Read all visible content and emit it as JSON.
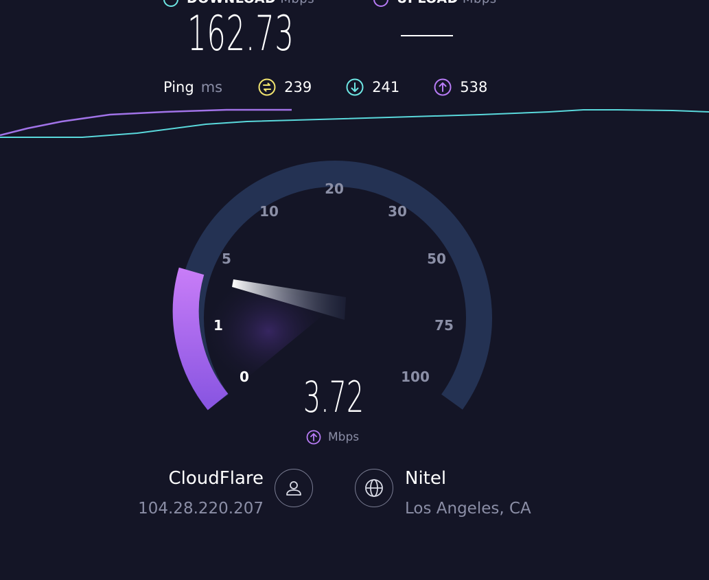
{
  "header": {
    "download": {
      "label": "DOWNLOAD",
      "unit": "Mbps",
      "value": "162.73"
    },
    "upload": {
      "label": "UPLOAD",
      "unit": "Mbps",
      "value": ""
    }
  },
  "ping": {
    "label": "Ping",
    "unit": "ms",
    "idle": "239",
    "download": "241",
    "upload": "538"
  },
  "gauge": {
    "labels": [
      "0",
      "1",
      "5",
      "10",
      "20",
      "30",
      "50",
      "75",
      "100"
    ],
    "value": "3.72",
    "unit": "Mbps",
    "mode": "upload"
  },
  "provider": {
    "name": "CloudFlare",
    "ip": "104.28.220.207"
  },
  "server": {
    "name": "Nitel",
    "location": "Los Angeles, CA"
  },
  "colors": {
    "background": "#141526",
    "download_accent": "#6ee7e4",
    "upload_accent": "#b77bf5",
    "idle_ping": "#f1e46f",
    "gauge_track": "#243253"
  },
  "icons": {
    "download": "download-arrow-icon",
    "upload": "upload-arrow-icon",
    "idle_ping": "ping-idle-icon",
    "user": "user-icon",
    "globe": "globe-icon"
  }
}
